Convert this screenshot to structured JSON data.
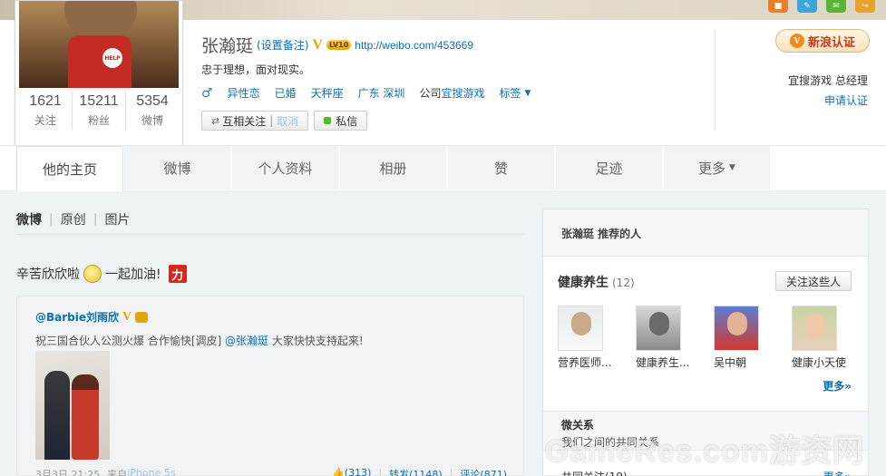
{
  "profile": {
    "name": "张瀚珽",
    "set_remark": "(设置备注)",
    "v_badge": "V",
    "level_badge": "LV10",
    "url": "http://weibo.com/453669",
    "bio": "忠于理想，面对现实。",
    "gender_icon": "♂",
    "orientation": "异性恋",
    "marital": "已婚",
    "zodiac": "天秤座",
    "location": "广东 深圳",
    "company_prefix": "公司",
    "company": "宜搜游戏",
    "tags": "标签",
    "mutual_follow": "互相关注",
    "cancel": "取消",
    "private_message": "私信",
    "stats": [
      {
        "num": "1621",
        "label": "关注"
      },
      {
        "num": "15211",
        "label": "粉丝"
      },
      {
        "num": "5354",
        "label": "微博"
      }
    ]
  },
  "verify": {
    "badge_letter": "V",
    "button_label": "新浪认证",
    "title": "宜搜游戏 总经理",
    "apply": "申请认证"
  },
  "tabs": [
    {
      "label": "他的主页"
    },
    {
      "label": "微博"
    },
    {
      "label": "个人资料"
    },
    {
      "label": "相册"
    },
    {
      "label": "赞"
    },
    {
      "label": "足迹"
    },
    {
      "label": "更多"
    }
  ],
  "feed": {
    "tab_all": "微博",
    "tab_original": "原创",
    "tab_photos": "图片",
    "post_text_1": "辛苦欣欣啦",
    "post_text_2": "一起加油!",
    "li_badge": "力",
    "repost": {
      "author": "@Barbie刘雨欣",
      "v_badge": "V",
      "text_1": "祝三国合伙人公测火爆 合作愉快[调皮] ",
      "mention": "@张瀚珽",
      "text_2": " 大家快快支持起来!",
      "time": "3月3日 21:25",
      "source_prefix": "来自",
      "source": "iPhone 5s",
      "likes": "(313)",
      "forward": "转发(1148)",
      "comment": "评论(871)"
    }
  },
  "sidebar": {
    "header": "张瀚珽 推荐的人",
    "group_title": "健康养生",
    "group_count": "(12)",
    "follow_all": "关注这些人",
    "people": [
      {
        "name": "营养医师..."
      },
      {
        "name": "健康养生..."
      },
      {
        "name": "吴中朝"
      },
      {
        "name": "健康小天使"
      }
    ],
    "more": "更多»",
    "relation_title": "微关系",
    "relation_desc": "我们之间的共同关系",
    "common_follow": "共同关注(19)",
    "common_more": "更多»"
  },
  "watermark": "GameRes.com游资网",
  "colors": {
    "link": "#0a6fb3",
    "verify_orange": "#f08a1d",
    "li_red": "#d7281f"
  }
}
